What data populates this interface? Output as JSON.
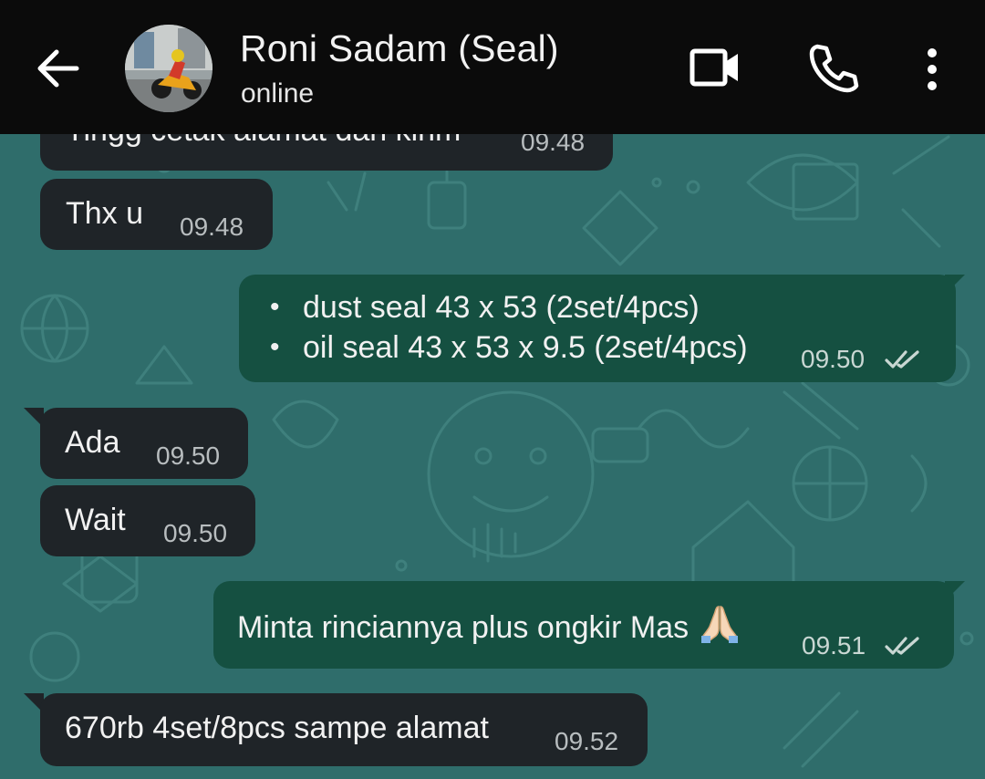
{
  "header": {
    "contact_name": "Roni Sadam (Seal)",
    "status": "online"
  },
  "messages": [
    {
      "direction": "incoming",
      "text": "Tingg cetak alamat dan kirim",
      "time": "09.48"
    },
    {
      "direction": "incoming",
      "text": "Thx u",
      "time": "09.48"
    },
    {
      "direction": "outgoing",
      "items": [
        "dust seal 43 x 53 (2set/4pcs)",
        "oil seal 43 x 53 x 9.5 (2set/4pcs)"
      ],
      "time": "09.50",
      "status": "read"
    },
    {
      "direction": "incoming",
      "text": "Ada",
      "time": "09.50"
    },
    {
      "direction": "incoming",
      "text": "Wait",
      "time": "09.50"
    },
    {
      "direction": "outgoing",
      "text": "Minta rinciannya plus ongkir Mas",
      "emoji": "folded-hands-emoji",
      "time": "09.51",
      "status": "read"
    },
    {
      "direction": "incoming",
      "text": "670rb 4set/8pcs sampe alamat",
      "time": "09.52"
    }
  ],
  "colors": {
    "header_bg": "#0b0b0b",
    "wallpaper": "#2f6d6b",
    "incoming_bubble": "#1f2428",
    "outgoing_bubble": "#155041",
    "timestamp": "#b8bdbf"
  },
  "icons": {
    "back": "arrow-left-icon",
    "video": "video-camera-icon",
    "call": "phone-icon",
    "menu": "more-vertical-icon",
    "read_receipt": "double-check-icon"
  }
}
